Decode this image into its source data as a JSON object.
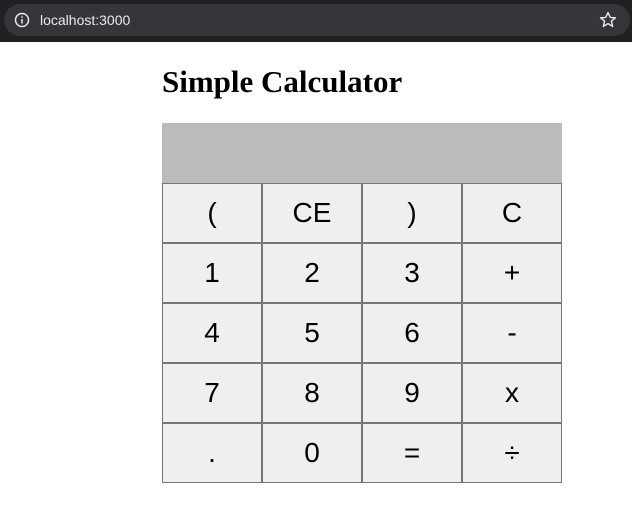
{
  "browser": {
    "url": "localhost:3000",
    "info_icon": "info-icon",
    "bookmark_icon": "star-icon"
  },
  "page": {
    "title": "Simple Calculator"
  },
  "calculator": {
    "display": "",
    "keys": [
      "(",
      "CE",
      ")",
      "C",
      "1",
      "2",
      "3",
      "+",
      "4",
      "5",
      "6",
      "-",
      "7",
      "8",
      "9",
      "x",
      ".",
      "0",
      "=",
      "÷"
    ]
  },
  "colors": {
    "browser_bar": "#202124",
    "address_pill": "#35363a",
    "display_bg": "#bbbbbb",
    "key_bg": "#efefef",
    "key_border": "#767676"
  }
}
